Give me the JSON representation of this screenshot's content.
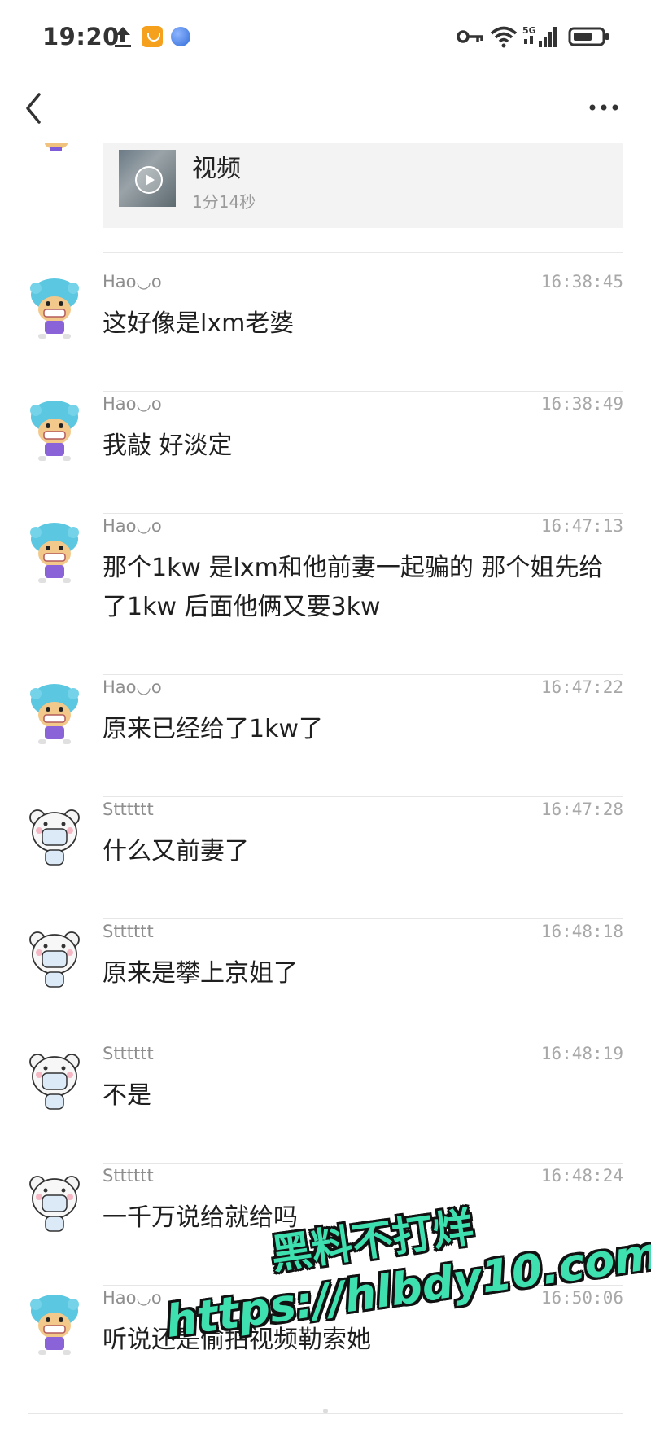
{
  "status_bar": {
    "time": "19:20",
    "network": "5G",
    "icons": [
      "upload-icon",
      "app-icon",
      "globe-icon",
      "key-icon",
      "wifi-icon",
      "signal-icon",
      "battery-icon"
    ]
  },
  "nav": {
    "back_icon": "back-icon",
    "more_icon": "more-icon"
  },
  "video": {
    "title": "视频",
    "duration": "1分14秒"
  },
  "messages": [
    {
      "sender": "Hao◡o",
      "time": "16:38:45",
      "text": "这好像是lxm老婆",
      "avatar": "haoo-avatar"
    },
    {
      "sender": "Hao◡o",
      "time": "16:38:49",
      "text": "我敲 好淡定",
      "avatar": "haoo-avatar"
    },
    {
      "sender": "Hao◡o",
      "time": "16:47:13",
      "text": "那个1kw 是lxm和他前妻一起骗的 那个姐先给了1kw 后面他俩又要3kw",
      "avatar": "haoo-avatar"
    },
    {
      "sender": "Hao◡o",
      "time": "16:47:22",
      "text": "原来已经给了1kw了",
      "avatar": "haoo-avatar"
    },
    {
      "sender": "Stttttt",
      "time": "16:47:28",
      "text": "什么又前妻了",
      "avatar": "bear-avatar"
    },
    {
      "sender": "Stttttt",
      "time": "16:48:18",
      "text": "原来是攀上京姐了",
      "avatar": "bear-avatar"
    },
    {
      "sender": "Stttttt",
      "time": "16:48:19",
      "text": "不是",
      "avatar": "bear-avatar"
    },
    {
      "sender": "Stttttt",
      "time": "16:48:24",
      "text": "一千万说给就给吗",
      "avatar": "bear-avatar"
    },
    {
      "sender": "Hao◡o",
      "time": "16:50:06",
      "text": "听说还是偷拍视频勒索她",
      "avatar": "haoo-avatar"
    }
  ],
  "watermark": {
    "line1": "黑料不打烊",
    "line2": "https://hlbdy10.com"
  },
  "colors": {
    "watermark": "#3fe0b0",
    "haoo_avatar": "#5bc7e0",
    "bear_avatar": "#f2f2f2"
  }
}
